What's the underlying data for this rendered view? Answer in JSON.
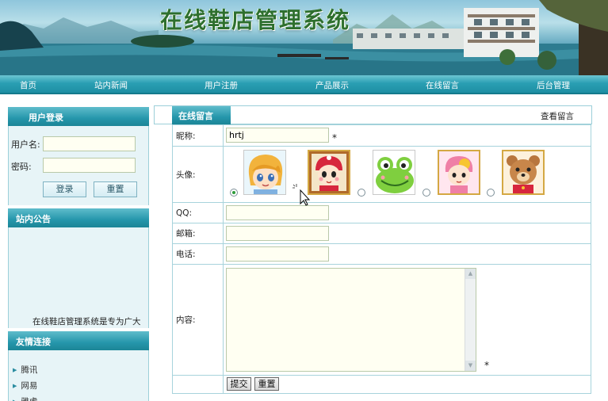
{
  "site": {
    "title": "在线鞋店管理系统"
  },
  "nav": {
    "items": [
      {
        "label": "首页"
      },
      {
        "label": "站内新闻"
      },
      {
        "label": "用户注册"
      },
      {
        "label": "产品展示"
      },
      {
        "label": "在线留言"
      },
      {
        "label": "后台管理"
      }
    ]
  },
  "login": {
    "title": "用户登录",
    "username_label": "用户名:",
    "password_label": "密码:",
    "username_value": "",
    "password_value": "",
    "login_button": "登录",
    "reset_button": "重置"
  },
  "notice": {
    "title": "站内公告",
    "text": "在线鞋店管理系统是专为广大"
  },
  "links": {
    "title": "友情连接",
    "items": [
      {
        "label": "腾讯"
      },
      {
        "label": "网易"
      },
      {
        "label": "雅虎"
      }
    ]
  },
  "message": {
    "tab_label": "在线留言",
    "view_link": "查看留言",
    "form": {
      "nickname_label": "昵称:",
      "nickname_value": "hrtj",
      "required_mark": "*",
      "avatar_label": "头像:",
      "avatars": [
        {
          "icon": "avatar-blonde-girl-icon",
          "selected": true
        },
        {
          "icon": "avatar-red-hat-girl-icon",
          "selected": false
        },
        {
          "icon": "avatar-frog-icon",
          "selected": false
        },
        {
          "icon": "avatar-pink-girl-icon",
          "selected": false
        },
        {
          "icon": "avatar-bear-icon",
          "selected": false
        }
      ],
      "qq_label": "QQ:",
      "email_label": "邮箱:",
      "phone_label": "电话:",
      "content_label": "内容:",
      "submit_button": "提交",
      "reset_button": "重置"
    }
  },
  "colors": {
    "nav_bg": "#2a9fb3",
    "panel_head": "#2596ab",
    "border": "#a7d3dc",
    "title_green": "#2e6f2e"
  }
}
